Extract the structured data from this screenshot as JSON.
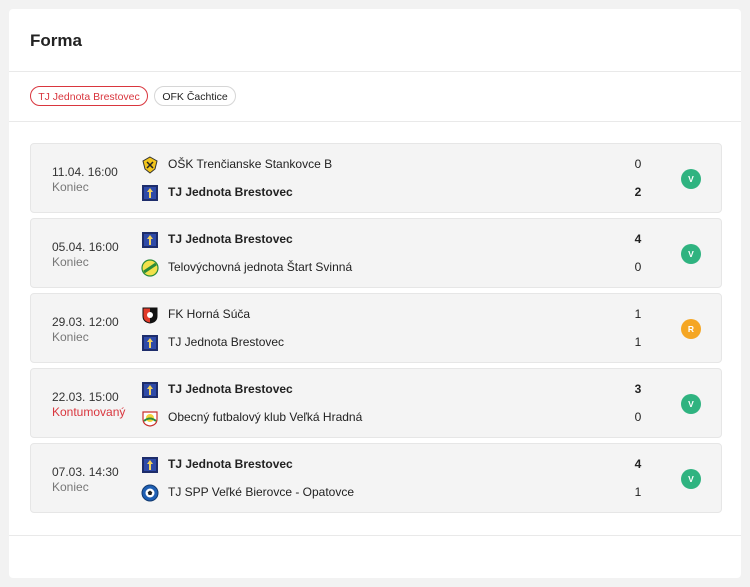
{
  "title": "Forma",
  "tabs": [
    {
      "label": "TJ Jednota Brestovec"
    },
    {
      "label": "OFK Čachtice"
    }
  ],
  "colors": {
    "win": "#2fb380",
    "draw": "#f5a623",
    "accent": "#d9363e"
  },
  "matches": [
    {
      "date": "11.04. 16:00",
      "status": "Koniec",
      "home": {
        "name": "OŠK Trenčianske Stankovce B",
        "score": "0",
        "logo": "shield-yellow-icon"
      },
      "away": {
        "name": "TJ Jednota Brestovec",
        "score": "2",
        "logo": "brestovec-crest-icon"
      },
      "result": "V"
    },
    {
      "date": "05.04. 16:00",
      "status": "Koniec",
      "home": {
        "name": "TJ Jednota Brestovec",
        "score": "4",
        "logo": "brestovec-crest-icon"
      },
      "away": {
        "name": "Telovýchovná jednota Štart Svinná",
        "score": "0",
        "logo": "svinna-crest-icon"
      },
      "result": "V"
    },
    {
      "date": "29.03. 12:00",
      "status": "Koniec",
      "home": {
        "name": "FK Horná Súča",
        "score": "1",
        "logo": "horna-suca-crest-icon"
      },
      "away": {
        "name": "TJ Jednota Brestovec",
        "score": "1",
        "logo": "brestovec-crest-icon"
      },
      "result": "R"
    },
    {
      "date": "22.03. 15:00",
      "status": "Kontumovaný",
      "home": {
        "name": "TJ Jednota Brestovec",
        "score": "3",
        "logo": "brestovec-crest-icon"
      },
      "away": {
        "name": "Obecný futbalový klub Veľká Hradná",
        "score": "0",
        "logo": "velka-hradna-crest-icon"
      },
      "result": "V"
    },
    {
      "date": "07.03. 14:30",
      "status": "Koniec",
      "home": {
        "name": "TJ Jednota Brestovec",
        "score": "4",
        "logo": "brestovec-crest-icon"
      },
      "away": {
        "name": "TJ SPP Veľké Bierovce - Opatovce",
        "score": "1",
        "logo": "ball-crest-icon"
      },
      "result": "V"
    }
  ]
}
